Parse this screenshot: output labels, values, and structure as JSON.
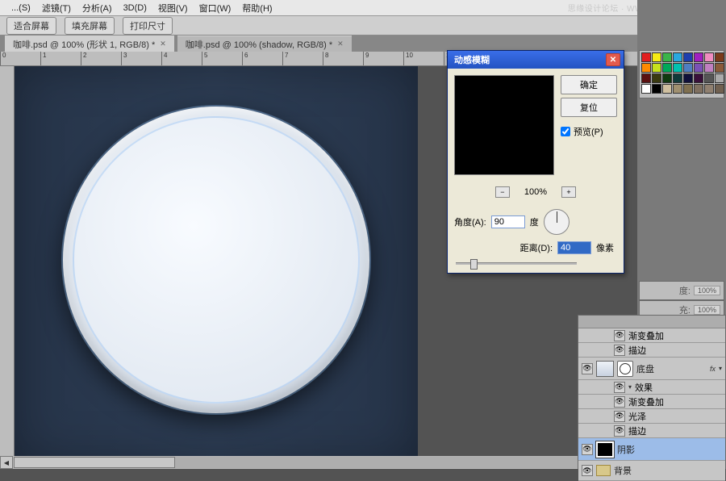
{
  "watermark": "思缘设计论坛 · WWW.MISSYUAN.COM",
  "menu": {
    "m1": "...(S)",
    "m2": "滤镜(T)",
    "m3": "分析(A)",
    "m4": "3D(D)",
    "m5": "视图(V)",
    "m6": "窗口(W)",
    "m7": "帮助(H)"
  },
  "options": {
    "b1": "适合屏幕",
    "b2": "填充屏幕",
    "b3": "打印尺寸"
  },
  "tabs": {
    "t1": "咖啡.psd @ 100% (形状 1, RGB/8) *",
    "t2": "咖啡.psd @ 100% (shadow, RGB/8) *"
  },
  "dialog": {
    "title": "动感模糊",
    "ok": "确定",
    "reset": "复位",
    "preview": "预览(P)",
    "zoom": "100%",
    "angle_lbl": "角度(A):",
    "angle_val": "90",
    "angle_unit": "度",
    "dist_lbl": "距离(D):",
    "dist_val": "40",
    "dist_unit": "像素"
  },
  "rightpanels": {
    "p1_lbl": "度:",
    "p1_val": "100%",
    "p2_lbl": "充:",
    "p2_val": "100%"
  },
  "layers": {
    "l1": "渐变叠加",
    "l2": "描边",
    "l3": "底盘",
    "l3b": "效果",
    "l3c": "渐变叠加",
    "l3d": "光泽",
    "l3e": "描边",
    "l4": "阴影",
    "l5": "背景",
    "fx": "fx"
  },
  "swatch_colors": [
    "#e21f1f",
    "#f5ea14",
    "#3bb44a",
    "#29a8df",
    "#1f3fae",
    "#a020c0",
    "#f08dc0",
    "#7a3a1a",
    "#ff8a00",
    "#c7e01b",
    "#00a859",
    "#00c2b0",
    "#4f7ec1",
    "#7a52b6",
    "#c080c0",
    "#8a5a3a",
    "#5b1010",
    "#3a3a10",
    "#103a10",
    "#103a3a",
    "#10103a",
    "#3a103a",
    "#555555",
    "#aaaaaa",
    "#ffffff",
    "#000000",
    "#d0c0a0",
    "#a09070",
    "#807050",
    "#807060",
    "#908070",
    "#706050"
  ]
}
